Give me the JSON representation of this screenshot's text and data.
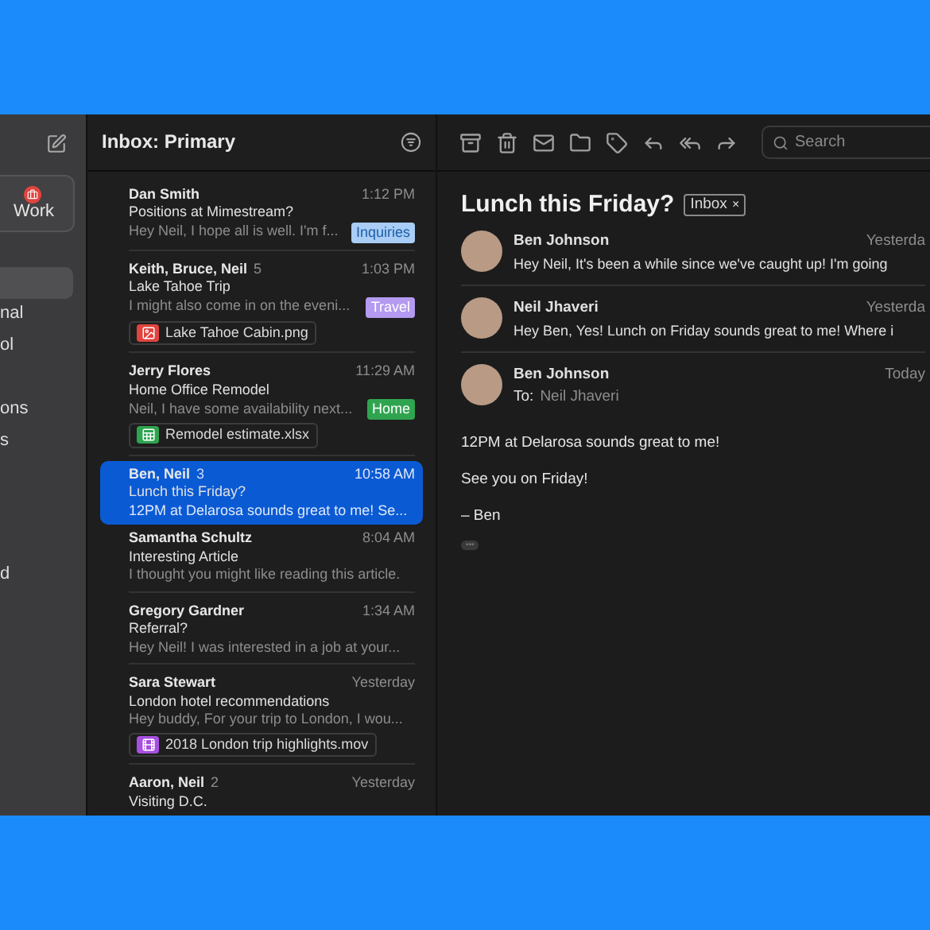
{
  "sidebar": {
    "account": {
      "label": "Work"
    },
    "items": [
      {
        "selected": true
      },
      {
        "label": "nal",
        "selected": false
      },
      {
        "label": "ol",
        "selected": false
      },
      {
        "label": "ons",
        "selected": false
      },
      {
        "label": "s",
        "selected": false
      },
      {
        "label": "d",
        "selected": false
      }
    ]
  },
  "list": {
    "title": "Inbox: Primary",
    "rows": [
      {
        "sender": "Dan Smith",
        "time": "1:12 PM",
        "subject": "Positions at Mimestream?",
        "preview": "Hey Neil, I hope all is well. I'm f...",
        "tag": {
          "label": "Inquiries",
          "color": "#a9cdf5"
        },
        "selected": false
      },
      {
        "sender": "Keith, Bruce, Neil",
        "count": "5",
        "time": "1:03 PM",
        "subject": "Lake Tahoe Trip",
        "preview": "I might also come in on the eveni...",
        "tag": {
          "label": "Travel",
          "color": "#b49af0"
        },
        "attachment": {
          "kind": "image",
          "name": "Lake Tahoe Cabin.png"
        },
        "selected": false
      },
      {
        "sender": "Jerry Flores",
        "time": "11:29 AM",
        "subject": "Home Office Remodel",
        "preview": "Neil, I have some availability next...",
        "tag": {
          "label": "Home",
          "color": "#2fa44f"
        },
        "attachment": {
          "kind": "sheet",
          "name": "Remodel estimate.xlsx"
        },
        "selected": false
      },
      {
        "sender": "Ben, Neil",
        "count": "3",
        "time": "10:58 AM",
        "subject": "Lunch this Friday?",
        "preview": "12PM at Delarosa sounds great to me! Se...",
        "selected": true
      },
      {
        "sender": "Samantha Schultz",
        "time": "8:04 AM",
        "subject": "Interesting Article",
        "preview": "I thought you might like reading this article.",
        "selected": false
      },
      {
        "sender": "Gregory Gardner",
        "time": "1:34 AM",
        "subject": "Referral?",
        "preview": "Hey Neil! I was interested in a job at your...",
        "selected": false
      },
      {
        "sender": "Sara Stewart",
        "time": "Yesterday",
        "subject": "London hotel recommendations",
        "preview": "Hey buddy, For your trip to London, I wou...",
        "attachment": {
          "kind": "video",
          "name": "2018 London trip highlights.mov"
        },
        "selected": false
      },
      {
        "sender": "Aaron, Neil",
        "count": "2",
        "time": "Yesterday",
        "subject": "Visiting D.C.",
        "selected": false
      }
    ]
  },
  "reader": {
    "search": {
      "placeholder": "Search"
    },
    "title": "Lunch this Friday?",
    "label": "Inbox",
    "label_remove": "×",
    "messages": [
      {
        "sender": "Ben Johnson",
        "time": "Yesterda",
        "snippet": "Hey Neil, It's been a while since we've caught up! I'm going"
      },
      {
        "sender": "Neil Jhaveri",
        "time": "Yesterda",
        "snippet": "Hey Ben, Yes! Lunch on Friday sounds great to me! Where i"
      },
      {
        "sender": "Ben Johnson",
        "time": "Today",
        "to_label": "To:",
        "to": "Neil Jhaveri",
        "body": [
          "12PM at Delarosa sounds great to me!",
          "See you on Friday!",
          "– Ben"
        ],
        "more": "•••"
      }
    ]
  }
}
